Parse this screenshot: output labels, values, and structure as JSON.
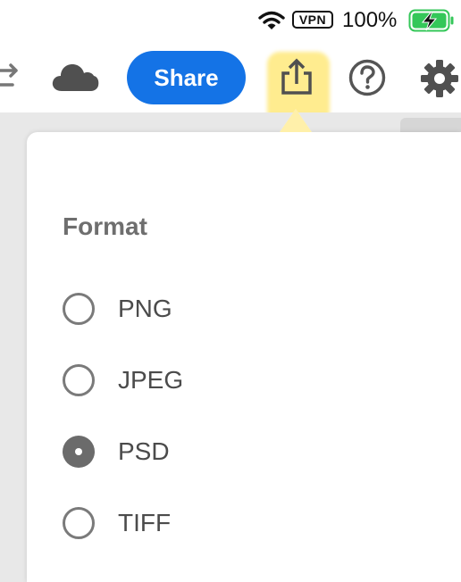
{
  "status_bar": {
    "vpn_label": "VPN",
    "battery_percent": "100%",
    "battery_level": 1.0,
    "battery_charging": true,
    "battery_color": "#34c759",
    "icons": [
      "wifi-icon",
      "vpn-badge",
      "battery-charging-icon"
    ]
  },
  "toolbar": {
    "share_label": "Share",
    "share_color": "#1473e6",
    "highlight_color": "#ffe464",
    "icons": [
      "swap-icon",
      "cloud-icon",
      "export-icon",
      "help-icon",
      "gear-icon"
    ]
  },
  "export_popover": {
    "title": "Format",
    "options": [
      {
        "label": "PNG",
        "selected": false
      },
      {
        "label": "JPEG",
        "selected": false
      },
      {
        "label": "PSD",
        "selected": true
      },
      {
        "label": "TIFF",
        "selected": false
      }
    ]
  }
}
